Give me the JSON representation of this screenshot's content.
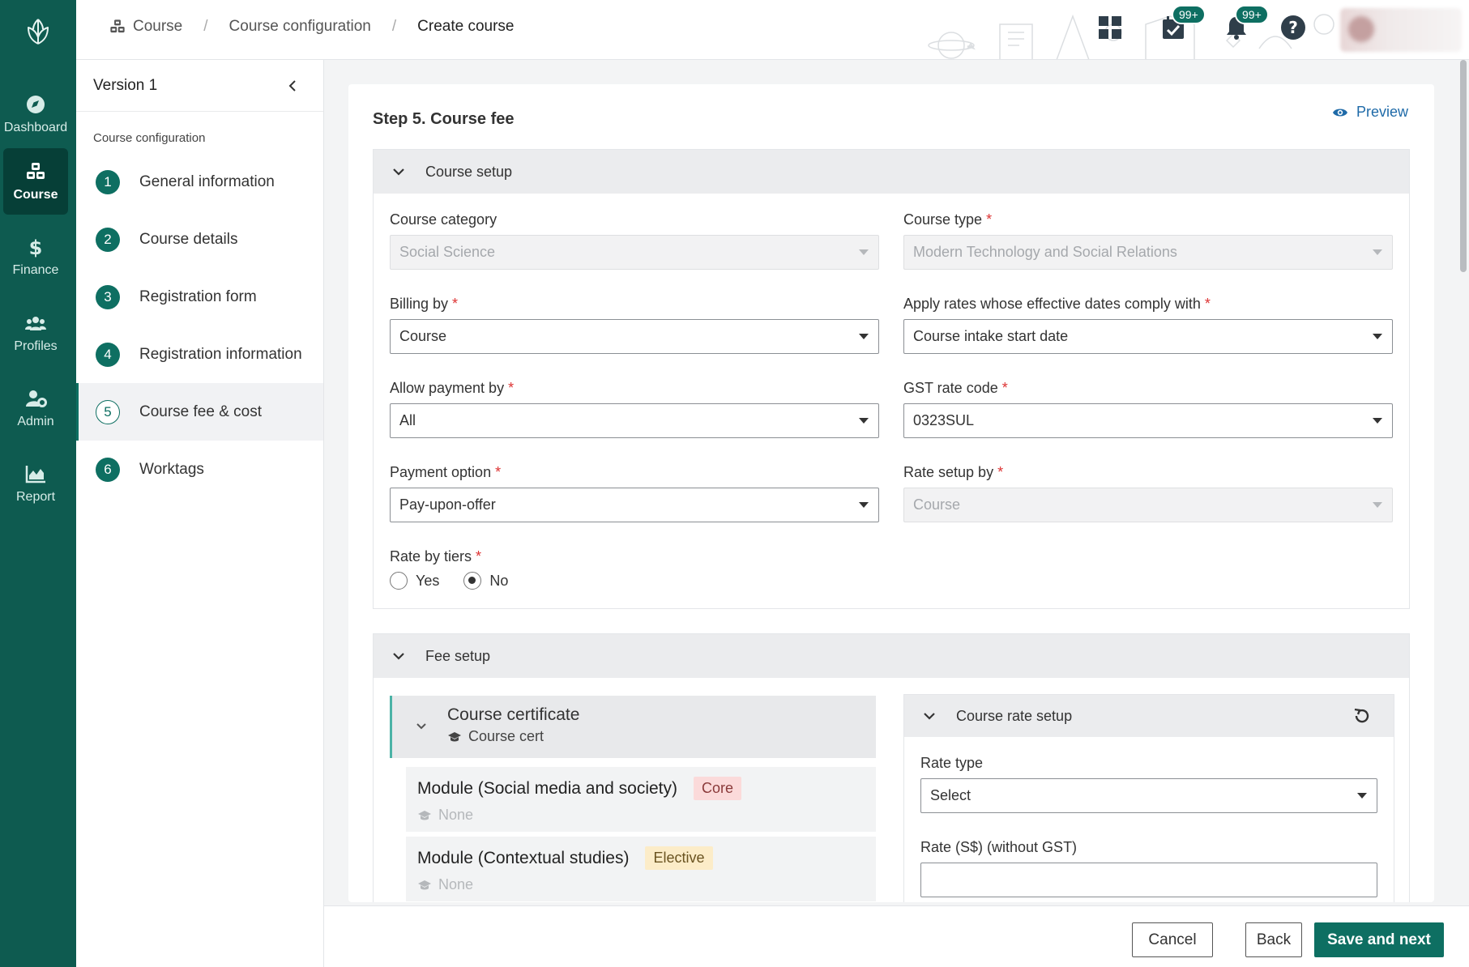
{
  "rail": {
    "items": [
      {
        "label": "Dashboard",
        "icon": "compass-icon"
      },
      {
        "label": "Course",
        "icon": "course-blocks-icon"
      },
      {
        "label": "Finance",
        "icon": "dollar-icon"
      },
      {
        "label": "Profiles",
        "icon": "people-icon"
      },
      {
        "label": "Admin",
        "icon": "user-gear-icon"
      },
      {
        "label": "Report",
        "icon": "chart-icon"
      }
    ],
    "active": "Course",
    "brand_color": "#0e5b50"
  },
  "topbar": {
    "breadcrumb": [
      "Course",
      "Course configuration",
      "Create course"
    ],
    "tasks_badge": "99+",
    "notifications_badge": "99+"
  },
  "sidenav": {
    "version": "Version 1",
    "subtitle": "Course configuration",
    "steps": [
      {
        "num": "1",
        "label": "General information"
      },
      {
        "num": "2",
        "label": "Course details"
      },
      {
        "num": "3",
        "label": "Registration form"
      },
      {
        "num": "4",
        "label": "Registration information"
      },
      {
        "num": "5",
        "label": "Course fee & cost"
      },
      {
        "num": "6",
        "label": "Worktags"
      }
    ],
    "active_step": "5"
  },
  "main": {
    "title": "Step 5. Course fee",
    "preview_label": "Preview",
    "course_setup": {
      "heading": "Course setup",
      "course_category": {
        "label": "Course category",
        "value": "Social Science"
      },
      "course_type": {
        "label": "Course type",
        "value": "Modern Technology and Social Relations"
      },
      "billing_by": {
        "label": "Billing by",
        "value": "Course"
      },
      "apply_rates": {
        "label": "Apply rates whose effective dates comply with",
        "value": "Course intake start date"
      },
      "allow_payment": {
        "label": "Allow payment by",
        "value": "All"
      },
      "gst_rate_code": {
        "label": "GST rate code",
        "value": "0323SUL"
      },
      "payment_option": {
        "label": "Payment option",
        "value": "Pay-upon-offer"
      },
      "rate_setup_by": {
        "label": "Rate setup by",
        "value": "Course"
      },
      "rate_by_tiers": {
        "label": "Rate by tiers",
        "yes": "Yes",
        "no": "No",
        "selected": "No"
      },
      "required_mark": "*"
    },
    "fee_setup": {
      "heading": "Fee setup",
      "certificate": {
        "title": "Course certificate",
        "sub": "Course cert"
      },
      "modules": [
        {
          "title": "Module (Social media and society)",
          "tag": "Core",
          "sub": "None"
        },
        {
          "title": "Module (Contextual studies)",
          "tag": "Elective",
          "sub": "None"
        }
      ],
      "rate_panel": {
        "heading": "Course rate setup",
        "rate_type_label": "Rate type",
        "rate_type_value": "Select",
        "rate_label": "Rate (S$) (without GST)",
        "rate_value": ""
      }
    }
  },
  "footer": {
    "cancel": "Cancel",
    "back": "Back",
    "save": "Save and next"
  }
}
